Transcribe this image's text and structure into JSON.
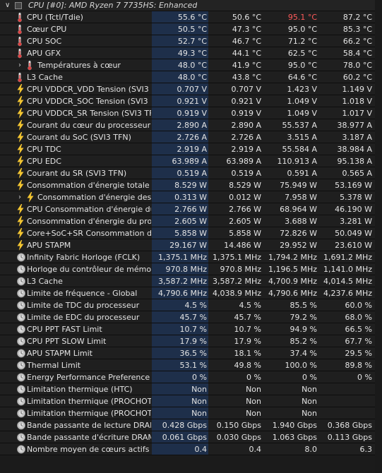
{
  "header": {
    "title": "CPU [#0]: AMD Ryzen 7 7735HS: Enhanced"
  },
  "rows": [
    {
      "icon": "thermometer-icon",
      "label": "CPU (Tctl/Tdie)",
      "v": [
        "55.6 °C",
        "50.6 °C",
        "95.1 °C",
        "87.2 °C"
      ],
      "red": 2
    },
    {
      "icon": "thermometer-icon",
      "label": "Cœur CPU",
      "v": [
        "50.5 °C",
        "47.3 °C",
        "95.0 °C",
        "85.3 °C"
      ]
    },
    {
      "icon": "thermometer-icon",
      "label": "CPU SOC",
      "v": [
        "52.7 °C",
        "46.7 °C",
        "71.2 °C",
        "66.2 °C"
      ]
    },
    {
      "icon": "thermometer-icon",
      "label": "APU GFX",
      "v": [
        "49.3 °C",
        "44.1 °C",
        "62.5 °C",
        "58.4 °C"
      ]
    },
    {
      "icon": "thermometer-icon",
      "label": "Températures à cœur",
      "v": [
        "48.0 °C",
        "41.9 °C",
        "95.0 °C",
        "78.0 °C"
      ],
      "sub": true
    },
    {
      "icon": "thermometer-icon",
      "label": "L3 Cache",
      "v": [
        "48.0 °C",
        "43.8 °C",
        "64.6 °C",
        "60.2 °C"
      ]
    },
    {
      "icon": "lightning-icon",
      "label": "CPU VDDCR_VDD Tension (SVI3 ...",
      "v": [
        "0.707 V",
        "0.707 V",
        "1.423 V",
        "1.149 V"
      ]
    },
    {
      "icon": "lightning-icon",
      "label": "CPU VDDCR_SOC Tension (SVI3 ...",
      "v": [
        "0.921 V",
        "0.921 V",
        "1.049 V",
        "1.018 V"
      ]
    },
    {
      "icon": "lightning-icon",
      "label": "CPU VDDCR_SR Tension (SVI3 TFN)",
      "v": [
        "0.919 V",
        "0.919 V",
        "1.049 V",
        "1.017 V"
      ]
    },
    {
      "icon": "lightning-icon",
      "label": "Courant du cœur du processeur ...",
      "v": [
        "2.890 A",
        "2.890 A",
        "55.537 A",
        "38.977 A"
      ]
    },
    {
      "icon": "lightning-icon",
      "label": "Courant du SoC (SVI3 TFN)",
      "v": [
        "2.726 A",
        "2.726 A",
        "3.515 A",
        "3.187 A"
      ]
    },
    {
      "icon": "lightning-icon",
      "label": "CPU TDC",
      "v": [
        "2.919 A",
        "2.919 A",
        "55.584 A",
        "38.984 A"
      ]
    },
    {
      "icon": "lightning-icon",
      "label": "CPU EDC",
      "v": [
        "63.989 A",
        "63.989 A",
        "110.913 A",
        "95.138 A"
      ]
    },
    {
      "icon": "lightning-icon",
      "label": "Courant du SR (SVI3 TFN)",
      "v": [
        "0.519 A",
        "0.519 A",
        "0.591 A",
        "0.565 A"
      ]
    },
    {
      "icon": "lightning-icon",
      "label": "Consommation d'énergie totale d...",
      "v": [
        "8.529 W",
        "8.529 W",
        "75.949 W",
        "53.169 W"
      ]
    },
    {
      "icon": "lightning-icon",
      "label": "Consommation d'énergie des ...",
      "v": [
        "0.313 W",
        "0.012 W",
        "7.958 W",
        "5.378 W"
      ],
      "sub": true
    },
    {
      "icon": "lightning-icon",
      "label": "CPU Consommation d'énergie du ...",
      "v": [
        "2.766 W",
        "2.766 W",
        "68.964 W",
        "46.190 W"
      ]
    },
    {
      "icon": "lightning-icon",
      "label": "Consommation d'énergie du proc...",
      "v": [
        "2.605 W",
        "2.605 W",
        "3.688 W",
        "3.281 W"
      ]
    },
    {
      "icon": "lightning-icon",
      "label": "Core+SoC+SR Consommation d'...",
      "v": [
        "5.858 W",
        "5.858 W",
        "72.826 W",
        "50.049 W"
      ]
    },
    {
      "icon": "lightning-icon",
      "label": "APU STAPM",
      "v": [
        "29.167 W",
        "14.486 W",
        "29.952 W",
        "23.610 W"
      ]
    },
    {
      "icon": "clock-icon",
      "label": "Infinity Fabric Horloge (FCLK)",
      "v": [
        "1,375.1 MHz",
        "1,375.1 MHz",
        "1,794.2 MHz",
        "1,691.2 MHz"
      ]
    },
    {
      "icon": "clock-icon",
      "label": "Horloge du contrôleur de mémoir...",
      "v": [
        "970.8 MHz",
        "970.8 MHz",
        "1,196.5 MHz",
        "1,141.0 MHz"
      ]
    },
    {
      "icon": "clock-icon",
      "label": "L3 Cache",
      "v": [
        "3,587.2 MHz",
        "3,587.2 MHz",
        "4,700.9 MHz",
        "4,014.5 MHz"
      ]
    },
    {
      "icon": "clock-icon",
      "label": "Limite de fréquence - Global",
      "v": [
        "4,790.6 MHz",
        "4,038.9 MHz",
        "4,790.6 MHz",
        "4,237.6 MHz"
      ]
    },
    {
      "icon": "clock-icon",
      "label": "Limite de TDC du processeur",
      "v": [
        "4.5 %",
        "4.5 %",
        "85.5 %",
        "60.0 %"
      ]
    },
    {
      "icon": "clock-icon",
      "label": "Limite de EDC du processeur",
      "v": [
        "45.7 %",
        "45.7 %",
        "79.2 %",
        "68.0 %"
      ]
    },
    {
      "icon": "clock-icon",
      "label": "CPU PPT FAST Limit",
      "v": [
        "10.7 %",
        "10.7 %",
        "94.9 %",
        "66.5 %"
      ]
    },
    {
      "icon": "clock-icon",
      "label": "CPU PPT SLOW Limit",
      "v": [
        "17.9 %",
        "17.9 %",
        "85.2 %",
        "67.7 %"
      ]
    },
    {
      "icon": "clock-icon",
      "label": "APU STAPM Limit",
      "v": [
        "36.5 %",
        "18.1 %",
        "37.4 %",
        "29.5 %"
      ]
    },
    {
      "icon": "clock-icon",
      "label": "Thermal Limit",
      "v": [
        "53.1 %",
        "49.8 %",
        "100.0 %",
        "89.8 %"
      ]
    },
    {
      "icon": "clock-icon",
      "label": "Energy Performance Preference",
      "v": [
        "0 %",
        "0 %",
        "0 %",
        "0 %"
      ]
    },
    {
      "icon": "clock-icon",
      "label": "Limitation thermique (HTC)",
      "v": [
        "Non",
        "Non",
        "Non",
        ""
      ]
    },
    {
      "icon": "clock-icon",
      "label": "Limitation thermique (PROCHOT ...",
      "v": [
        "Non",
        "Non",
        "Non",
        ""
      ]
    },
    {
      "icon": "clock-icon",
      "label": "Limitation thermique (PROCHOT ...",
      "v": [
        "Non",
        "Non",
        "Non",
        ""
      ]
    },
    {
      "icon": "clock-icon",
      "label": "Bande passante de lecture DRAM",
      "v": [
        "0.428 Gbps",
        "0.150 Gbps",
        "1.940 Gbps",
        "0.368 Gbps"
      ]
    },
    {
      "icon": "clock-icon",
      "label": "Bande passante d'écriture DRAM",
      "v": [
        "0.061 Gbps",
        "0.030 Gbps",
        "1.063 Gbps",
        "0.113 Gbps"
      ]
    },
    {
      "icon": "clock-icon",
      "label": "Nombre moyen de cœurs actifs",
      "v": [
        "0.4",
        "0.4",
        "8.0",
        "6.3"
      ]
    }
  ],
  "colors": {
    "current_column_bg": "#1e2f4a",
    "alert": "#ff5a5a",
    "background": "#1f1f1f"
  }
}
